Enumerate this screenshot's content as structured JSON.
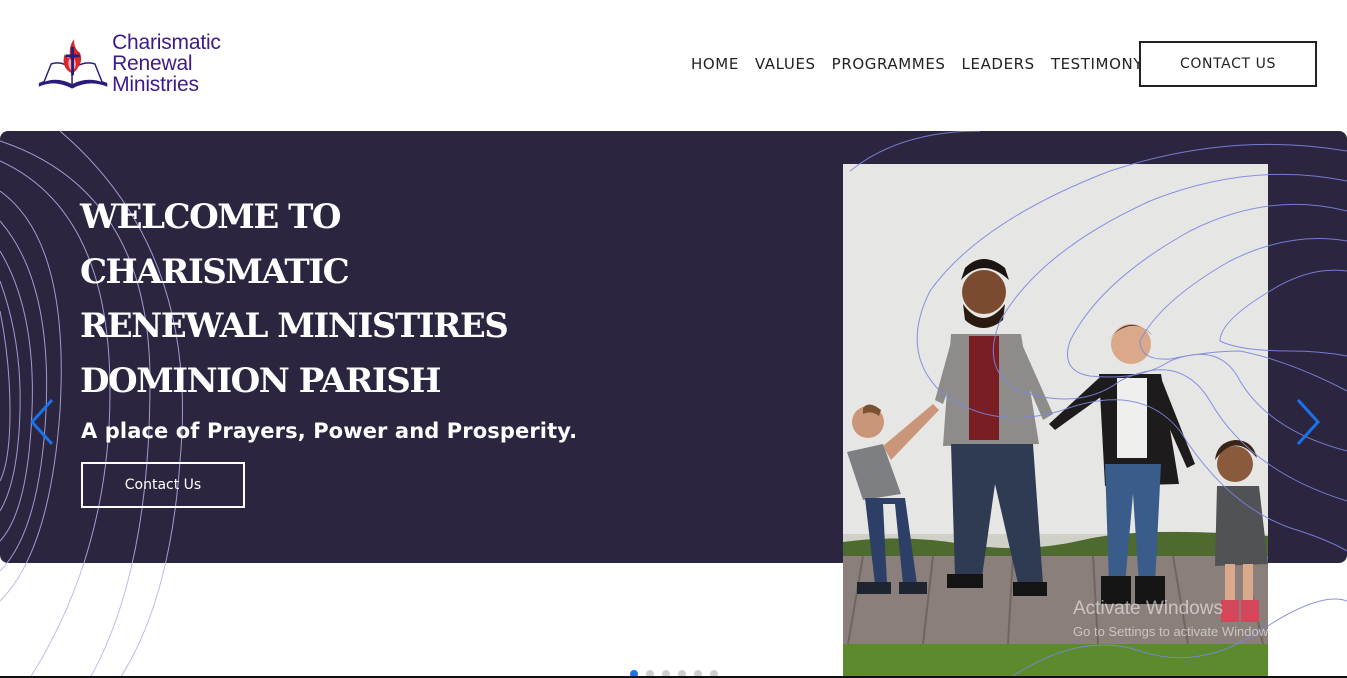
{
  "brand": {
    "name_line1": "Charismatic",
    "name_line2": "Renewal Ministries",
    "logo_icon": "flame-cross-book-icon",
    "color": "#3d1a8a"
  },
  "nav": {
    "items": [
      "HOME",
      "VALUES",
      "PROGRAMMES",
      "LEADERS",
      "TESTIMONY"
    ],
    "cta": "CONTACT US"
  },
  "hero": {
    "title_lines": [
      "WELCOME TO",
      "CHARISMATIC",
      "RENEWAL MINISTIRES",
      "DOMINION PARISH"
    ],
    "subtitle": "A place of Prayers, Power and Prosperity.",
    "button": "Contact Us",
    "prev_icon": "chevron-left-icon",
    "next_icon": "chevron-right-icon",
    "background": "#2c2540",
    "accent": "#1a73e8"
  },
  "photo": {
    "icon": "family-photo"
  },
  "carousel": {
    "slides": 6,
    "active": 1
  },
  "watermark": {
    "line1": "Activate Windows",
    "line2": "Go to Settings to activate Windows."
  }
}
